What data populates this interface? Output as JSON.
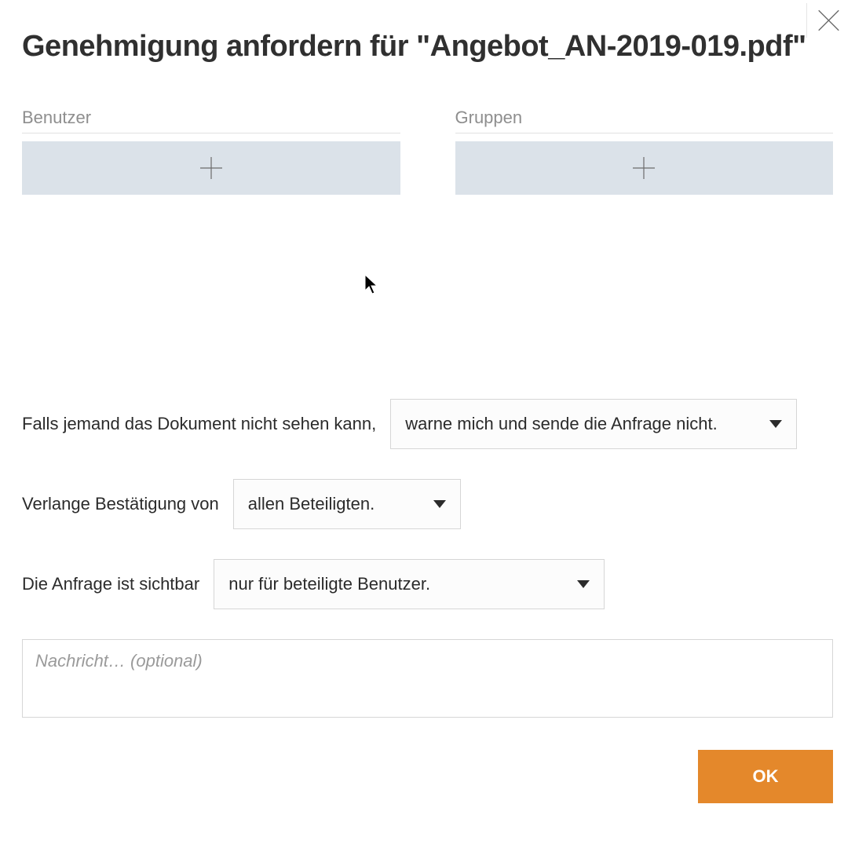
{
  "title": "Genehmigung anfordern für \"Angebot_AN-2019-019.pdf\"",
  "users": {
    "label": "Benutzer"
  },
  "groups": {
    "label": "Gruppen"
  },
  "row1": {
    "label": "Falls jemand das Dokument nicht sehen kann,",
    "selected": "warne mich und sende die Anfrage nicht."
  },
  "row2": {
    "label": "Verlange Bestätigung von",
    "selected": "allen Beteiligten."
  },
  "row3": {
    "label": "Die Anfrage ist sichtbar",
    "selected": "nur für beteiligte Benutzer."
  },
  "message": {
    "placeholder": "Nachricht… (optional)"
  },
  "ok": "OK"
}
